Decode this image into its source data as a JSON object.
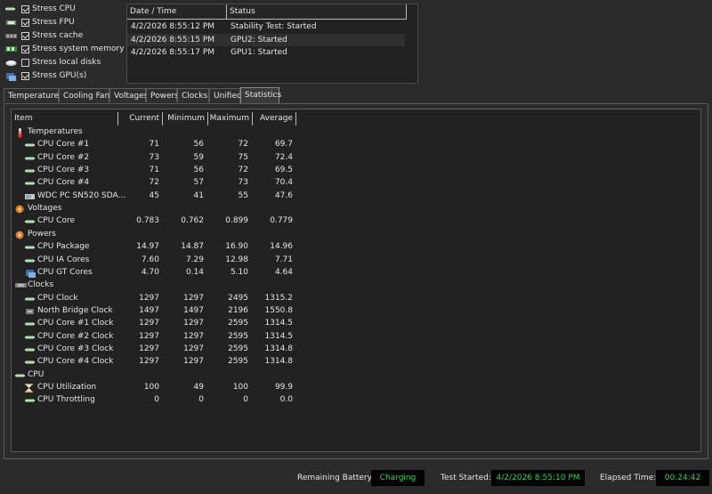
{
  "stress_options": [
    {
      "label": "Stress CPU",
      "checked": true,
      "icon": "cpu-chip-icon"
    },
    {
      "label": "Stress FPU",
      "checked": true,
      "icon": "fpu-icon"
    },
    {
      "label": "Stress cache",
      "checked": true,
      "icon": "cache-icon"
    },
    {
      "label": "Stress system memory",
      "checked": true,
      "icon": "memory-icon"
    },
    {
      "label": "Stress local disks",
      "checked": false,
      "icon": "disk-icon"
    },
    {
      "label": "Stress GPU(s)",
      "checked": true,
      "icon": "gpu-icon"
    }
  ],
  "log": {
    "headers": {
      "datetime": "Date / Time",
      "status": "Status"
    },
    "rows": [
      {
        "datetime": "4/2/2026 8:55:12 PM",
        "status": "Stability Test: Started"
      },
      {
        "datetime": "4/2/2026 8:55:15 PM",
        "status": "GPU2: Started"
      },
      {
        "datetime": "4/2/2026 8:55:17 PM",
        "status": "GPU1: Started"
      }
    ]
  },
  "tabs": [
    "Temperatures",
    "Cooling Fans",
    "Voltages",
    "Powers",
    "Clocks",
    "Unified",
    "Statistics"
  ],
  "active_tab": "Statistics",
  "stats": {
    "headers": {
      "item": "Item",
      "current": "Current",
      "minimum": "Minimum",
      "maximum": "Maximum",
      "average": "Average"
    },
    "groups": [
      {
        "name": "Temperatures",
        "icon": "thermometer-icon",
        "rows": [
          {
            "name": "CPU Core #1",
            "current": "71",
            "minimum": "56",
            "maximum": "72",
            "average": "69.7"
          },
          {
            "name": "CPU Core #2",
            "current": "73",
            "minimum": "59",
            "maximum": "75",
            "average": "72.4"
          },
          {
            "name": "CPU Core #3",
            "current": "71",
            "minimum": "56",
            "maximum": "72",
            "average": "69.5"
          },
          {
            "name": "CPU Core #4",
            "current": "72",
            "minimum": "57",
            "maximum": "73",
            "average": "70.4"
          },
          {
            "name": "WDC PC SN520 SDA...",
            "current": "45",
            "minimum": "41",
            "maximum": "55",
            "average": "47.6"
          }
        ]
      },
      {
        "name": "Voltages",
        "icon": "voltage-icon",
        "rows": [
          {
            "name": "CPU Core",
            "current": "0.783",
            "minimum": "0.762",
            "maximum": "0.899",
            "average": "0.779"
          }
        ]
      },
      {
        "name": "Powers",
        "icon": "power-icon",
        "rows": [
          {
            "name": "CPU Package",
            "current": "14.97",
            "minimum": "14.87",
            "maximum": "16.90",
            "average": "14.96"
          },
          {
            "name": "CPU IA Cores",
            "current": "7.60",
            "minimum": "7.29",
            "maximum": "12.98",
            "average": "7.71"
          },
          {
            "name": "CPU GT Cores",
            "current": "4.70",
            "minimum": "0.14",
            "maximum": "5.10",
            "average": "4.64"
          }
        ]
      },
      {
        "name": "Clocks",
        "icon": "clock-board-icon",
        "rows": [
          {
            "name": "CPU Clock",
            "current": "1297",
            "minimum": "1297",
            "maximum": "2495",
            "average": "1315.2"
          },
          {
            "name": "North Bridge Clock",
            "current": "1497",
            "minimum": "1497",
            "maximum": "2196",
            "average": "1550.8"
          },
          {
            "name": "CPU Core #1 Clock",
            "current": "1297",
            "minimum": "1297",
            "maximum": "2595",
            "average": "1314.5"
          },
          {
            "name": "CPU Core #2 Clock",
            "current": "1297",
            "minimum": "1297",
            "maximum": "2595",
            "average": "1314.5"
          },
          {
            "name": "CPU Core #3 Clock",
            "current": "1297",
            "minimum": "1297",
            "maximum": "2595",
            "average": "1314.8"
          },
          {
            "name": "CPU Core #4 Clock",
            "current": "1297",
            "minimum": "1297",
            "maximum": "2595",
            "average": "1314.8"
          }
        ]
      },
      {
        "name": "CPU",
        "icon": "cpu-chip-icon",
        "rows": [
          {
            "name": "CPU Utilization",
            "current": "100",
            "minimum": "49",
            "maximum": "100",
            "average": "99.9"
          },
          {
            "name": "CPU Throttling",
            "current": "0",
            "minimum": "0",
            "maximum": "0",
            "average": "0.0"
          }
        ]
      }
    ]
  },
  "status_bar": {
    "battery_label": "Remaining Battery:",
    "battery_value": "Charging",
    "test_started_label": "Test Started:",
    "test_started_value": "4/2/2026 8:55:10 PM",
    "elapsed_label": "Elapsed Time:",
    "elapsed_value": "00:24:42"
  },
  "colors": {
    "accent_green": "#39d353",
    "background": "#2b2b2b"
  }
}
